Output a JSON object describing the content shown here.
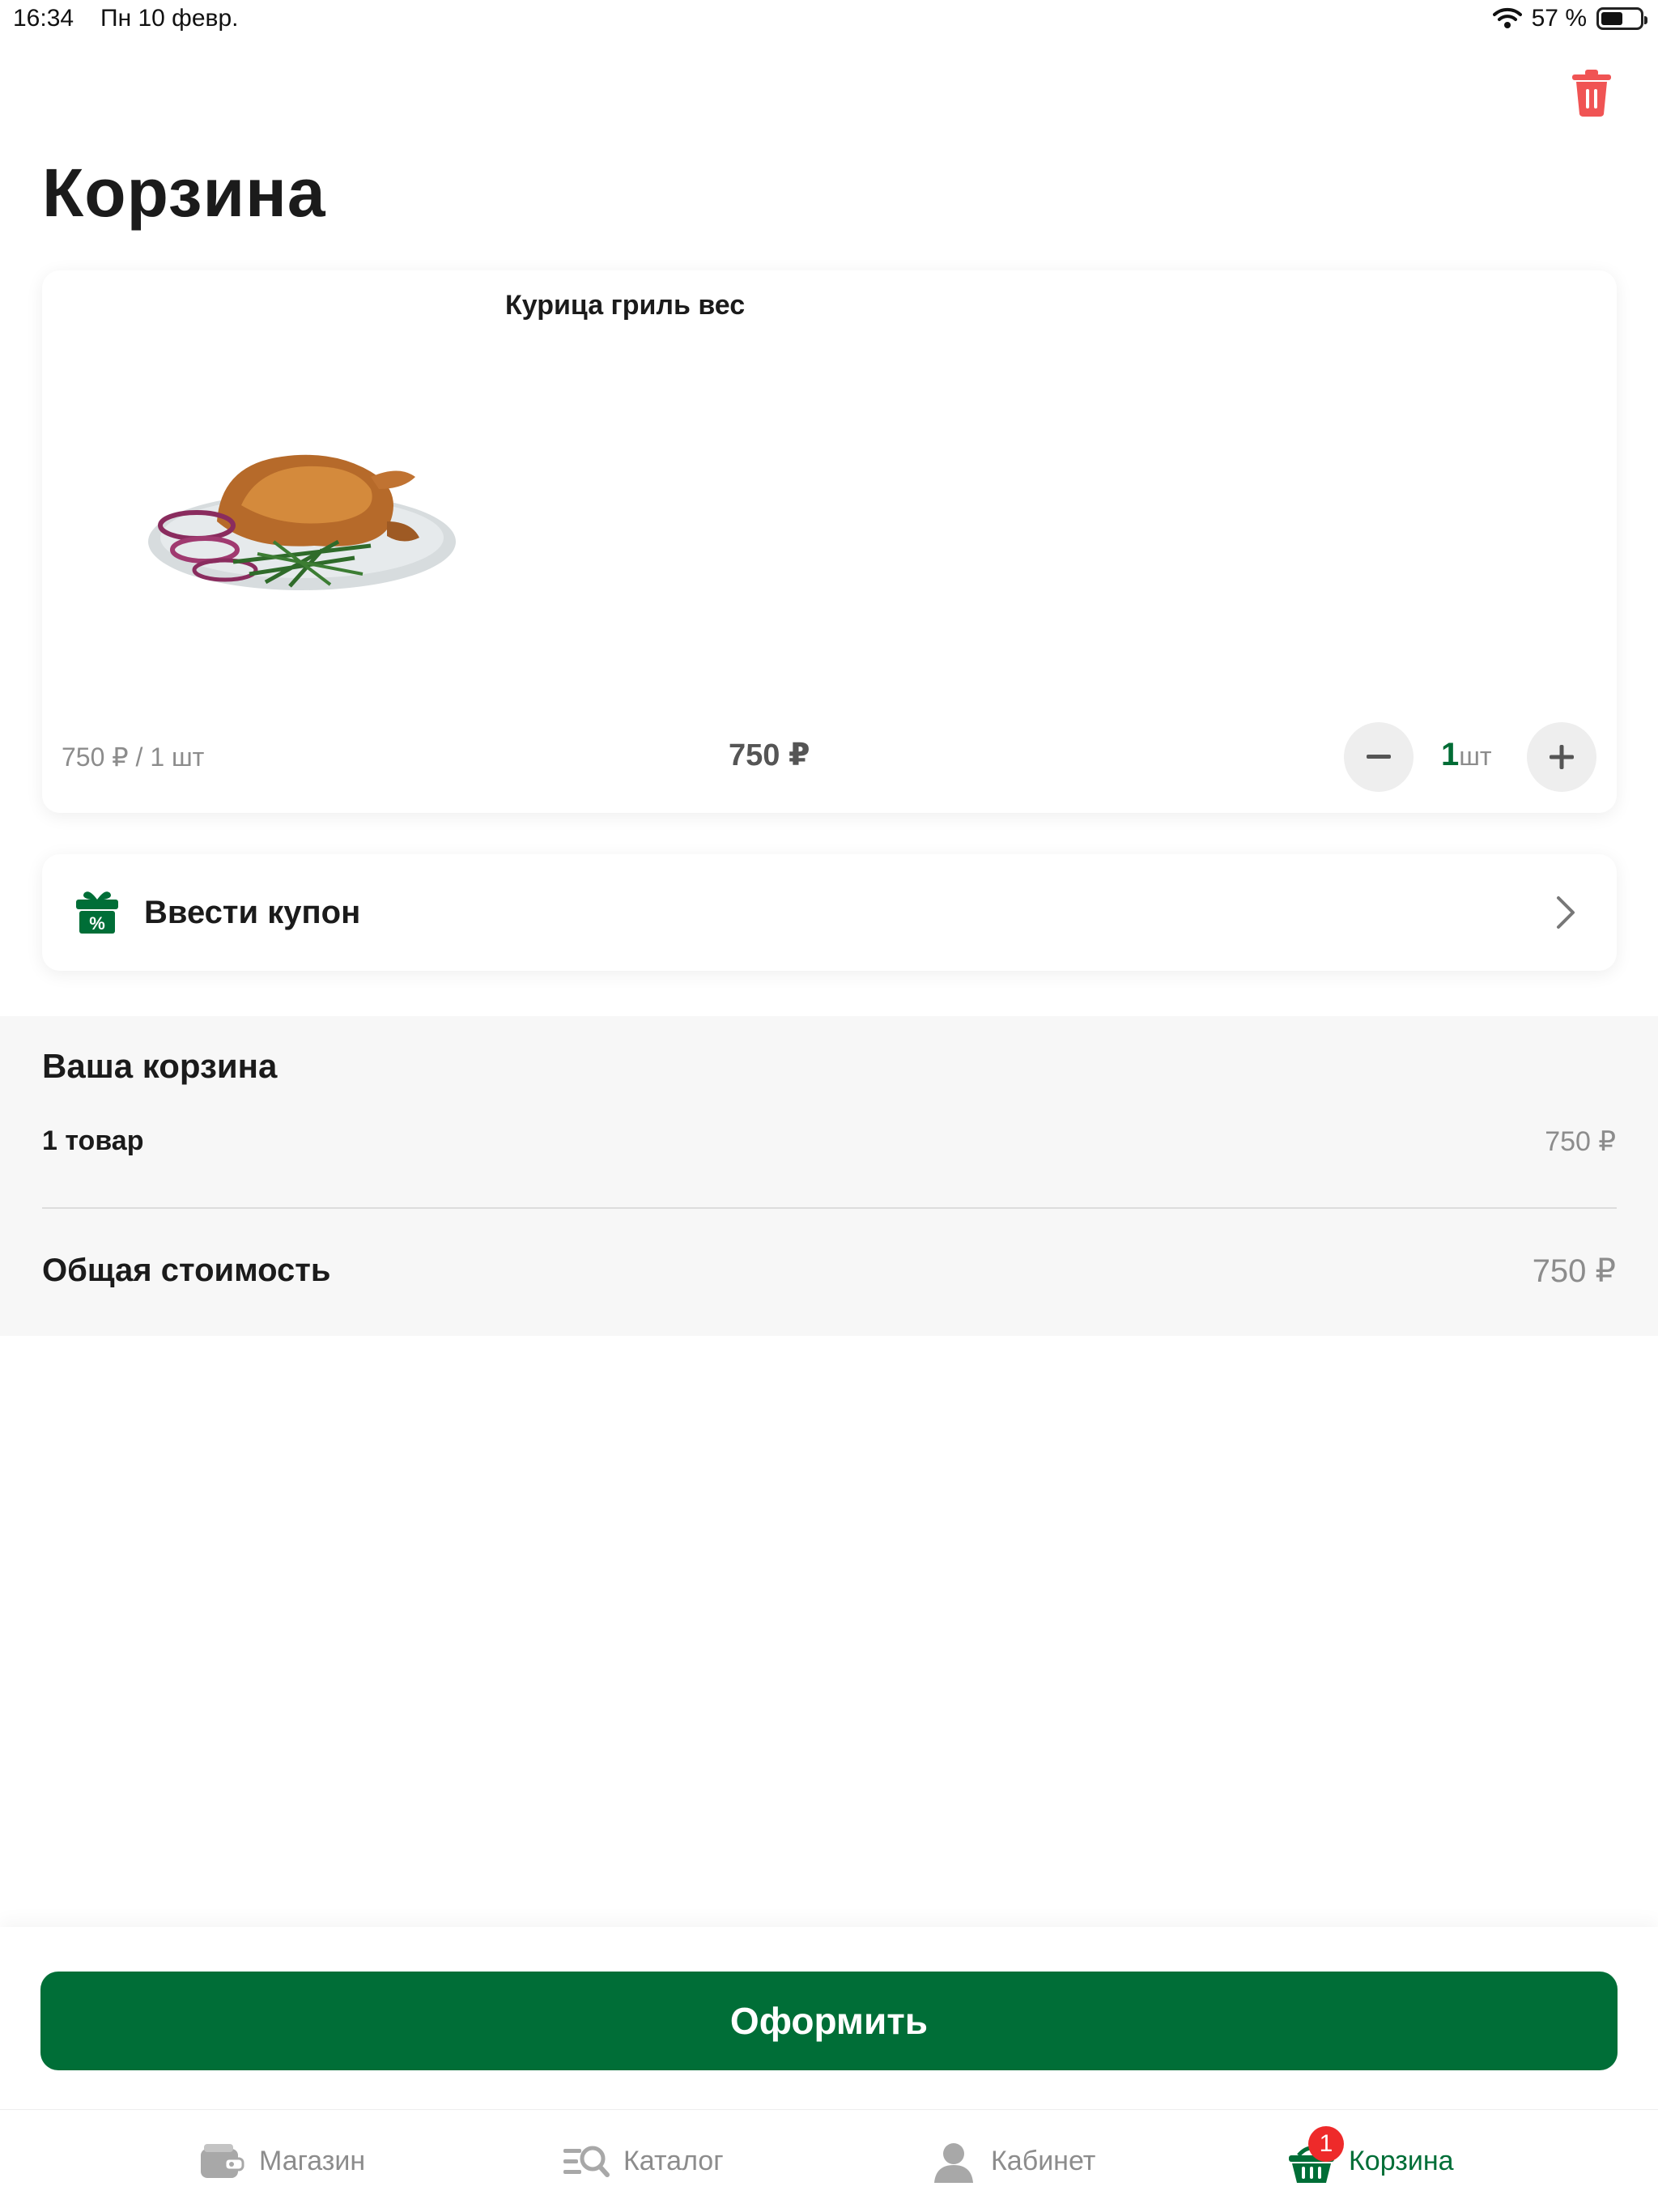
{
  "status_bar": {
    "time": "16:34",
    "date": "Пн 10 февр.",
    "battery_text": "57 %",
    "battery_level": 0.57
  },
  "header": {
    "title": "Корзина",
    "clear_icon": "trash-icon"
  },
  "cart": {
    "items": [
      {
        "name": "Курица гриль вес",
        "unit_price": "750 ₽ / 1 шт",
        "total": "750 ₽",
        "quantity": "1",
        "quantity_unit": "шт"
      }
    ]
  },
  "coupon": {
    "label": "Ввести купон",
    "icon": "gift-coupon-icon"
  },
  "summary": {
    "title": "Ваша корзина",
    "items_count": "1 товар",
    "items_price": "750 ₽",
    "total_label": "Общая стоимость",
    "total_price": "750 ₽"
  },
  "checkout": {
    "label": "Оформить"
  },
  "tab_bar": {
    "tabs": [
      {
        "label": "Магазин",
        "icon": "wallet-icon"
      },
      {
        "label": "Каталог",
        "icon": "catalog-search-icon"
      },
      {
        "label": "Кабинет",
        "icon": "user-icon"
      },
      {
        "label": "Корзина",
        "icon": "basket-icon",
        "badge": "1",
        "active": true
      }
    ]
  },
  "colors": {
    "accent": "#006e37",
    "danger": "#ee2a2a",
    "muted_text": "#8c8c8c"
  }
}
